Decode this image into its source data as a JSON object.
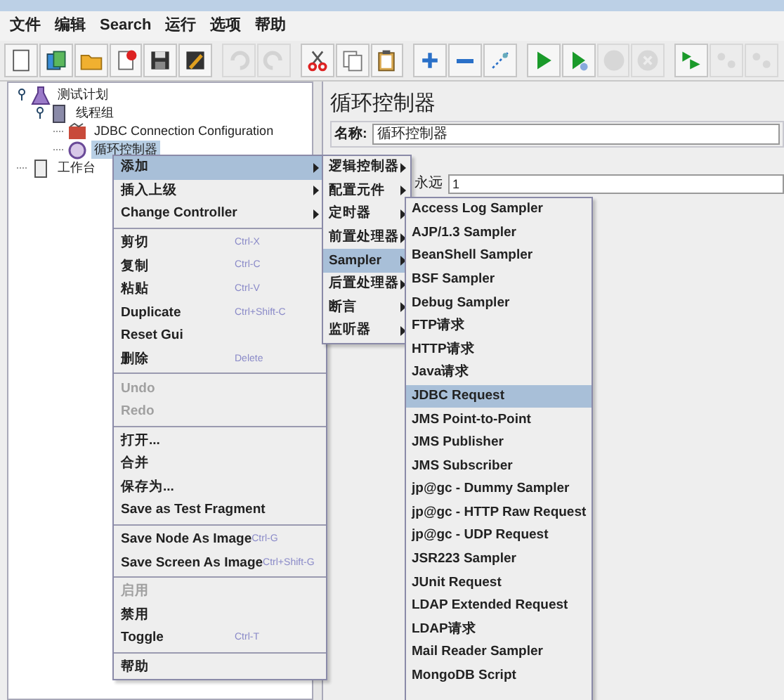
{
  "menu_bar": [
    "文件",
    "编辑",
    "Search",
    "运行",
    "选项",
    "帮助"
  ],
  "toolbar": [
    {
      "kind": "new",
      "disabled": false
    },
    {
      "kind": "templates",
      "disabled": false
    },
    {
      "kind": "open",
      "disabled": false
    },
    {
      "kind": "close",
      "disabled": false
    },
    {
      "kind": "save",
      "disabled": false
    },
    {
      "kind": "save-as",
      "disabled": false
    },
    {
      "kind": "undo",
      "disabled": true
    },
    {
      "kind": "redo",
      "disabled": true
    },
    {
      "kind": "cut",
      "disabled": false
    },
    {
      "kind": "copy",
      "disabled": false
    },
    {
      "kind": "paste",
      "disabled": false
    },
    {
      "kind": "expand",
      "disabled": false
    },
    {
      "kind": "collapse",
      "disabled": false
    },
    {
      "kind": "toggle",
      "disabled": false
    },
    {
      "kind": "start",
      "disabled": false
    },
    {
      "kind": "start-no-pause",
      "disabled": false
    },
    {
      "kind": "stop",
      "disabled": true
    },
    {
      "kind": "shutdown",
      "disabled": true
    },
    {
      "kind": "remote-start",
      "disabled": false
    },
    {
      "kind": "remote-stop",
      "disabled": true
    },
    {
      "kind": "remote-exit",
      "disabled": true
    }
  ],
  "tree": [
    {
      "label": "测试计划",
      "kind": "plan",
      "expanded": true,
      "selected": false,
      "children": [
        {
          "label": "线程组",
          "kind": "threads",
          "expanded": true,
          "selected": false,
          "children": [
            {
              "label": "JDBC Connection Configuration",
              "kind": "config",
              "selected": false
            },
            {
              "label": "循环控制器",
              "kind": "loop",
              "selected": true
            }
          ]
        }
      ]
    },
    {
      "label": "工作台",
      "kind": "workbench",
      "selected": false
    }
  ],
  "editor": {
    "title": "循环控制器",
    "name_label": "名称:",
    "name_value": "循环控制器",
    "forever_label": "永远",
    "loop_count": "1"
  },
  "context_menu": [
    {
      "kind": "item",
      "label": "添加",
      "submenu": true,
      "selected": true,
      "disabled": false
    },
    {
      "kind": "item",
      "label": "插入上级",
      "submenu": true,
      "selected": false,
      "disabled": false
    },
    {
      "kind": "item",
      "label": "Change Controller",
      "submenu": true,
      "selected": false,
      "disabled": false
    },
    {
      "kind": "separator"
    },
    {
      "kind": "item",
      "label": "剪切",
      "shortcut": "Ctrl-X",
      "selected": false,
      "disabled": false
    },
    {
      "kind": "item",
      "label": "复制",
      "shortcut": "Ctrl-C",
      "selected": false,
      "disabled": false
    },
    {
      "kind": "item",
      "label": "粘贴",
      "shortcut": "Ctrl-V",
      "selected": false,
      "disabled": false
    },
    {
      "kind": "item",
      "label": "Duplicate",
      "shortcut": "Ctrl+Shift-C",
      "selected": false,
      "disabled": false
    },
    {
      "kind": "item",
      "label": "Reset Gui",
      "selected": false,
      "disabled": false
    },
    {
      "kind": "item",
      "label": "删除",
      "shortcut": "Delete",
      "selected": false,
      "disabled": false
    },
    {
      "kind": "separator"
    },
    {
      "kind": "item",
      "label": "Undo",
      "selected": false,
      "disabled": true
    },
    {
      "kind": "item",
      "label": "Redo",
      "selected": false,
      "disabled": true
    },
    {
      "kind": "separator"
    },
    {
      "kind": "item",
      "label": "打开...",
      "selected": false,
      "disabled": false
    },
    {
      "kind": "item",
      "label": "合并",
      "selected": false,
      "disabled": false
    },
    {
      "kind": "item",
      "label": "保存为...",
      "selected": false,
      "disabled": false
    },
    {
      "kind": "item",
      "label": "Save as Test Fragment",
      "selected": false,
      "disabled": false
    },
    {
      "kind": "separator"
    },
    {
      "kind": "item",
      "label": "Save Node As Image",
      "shortcut": "Ctrl-G",
      "selected": false,
      "disabled": false
    },
    {
      "kind": "item",
      "label": "Save Screen As Image",
      "shortcut": "Ctrl+Shift-G",
      "selected": false,
      "disabled": false
    },
    {
      "kind": "separator"
    },
    {
      "kind": "item",
      "label": "启用",
      "selected": false,
      "disabled": true
    },
    {
      "kind": "item",
      "label": "禁用",
      "selected": false,
      "disabled": false
    },
    {
      "kind": "item",
      "label": "Toggle",
      "shortcut": "Ctrl-T",
      "selected": false,
      "disabled": false
    },
    {
      "kind": "separator"
    },
    {
      "kind": "item",
      "label": "帮助",
      "selected": false,
      "disabled": false
    }
  ],
  "add_submenu": [
    {
      "label": "逻辑控制器",
      "selected": false
    },
    {
      "label": "配置元件",
      "selected": false
    },
    {
      "label": "定时器",
      "selected": false
    },
    {
      "label": "前置处理器",
      "selected": false
    },
    {
      "label": "Sampler",
      "selected": true
    },
    {
      "label": "后置处理器",
      "selected": false
    },
    {
      "label": "断言",
      "selected": false
    },
    {
      "label": "监听器",
      "selected": false
    }
  ],
  "sampler_submenu": [
    {
      "label": "Access Log Sampler",
      "selected": false
    },
    {
      "label": "AJP/1.3 Sampler",
      "selected": false
    },
    {
      "label": "BeanShell Sampler",
      "selected": false
    },
    {
      "label": "BSF Sampler",
      "selected": false
    },
    {
      "label": "Debug Sampler",
      "selected": false
    },
    {
      "label": "FTP请求",
      "selected": false
    },
    {
      "label": "HTTP请求",
      "selected": false
    },
    {
      "label": "Java请求",
      "selected": false
    },
    {
      "label": "JDBC Request",
      "selected": true
    },
    {
      "label": "JMS Point-to-Point",
      "selected": false
    },
    {
      "label": "JMS Publisher",
      "selected": false
    },
    {
      "label": "JMS Subscriber",
      "selected": false
    },
    {
      "label": "jp@gc - Dummy Sampler",
      "selected": false
    },
    {
      "label": "jp@gc - HTTP Raw Request",
      "selected": false
    },
    {
      "label": "jp@gc - UDP Request",
      "selected": false
    },
    {
      "label": "JSR223 Sampler",
      "selected": false
    },
    {
      "label": "JUnit Request",
      "selected": false
    },
    {
      "label": "LDAP Extended Request",
      "selected": false
    },
    {
      "label": "LDAP请求",
      "selected": false
    },
    {
      "label": "Mail Reader Sampler",
      "selected": false
    },
    {
      "label": "MongoDB Script",
      "selected": false
    }
  ]
}
